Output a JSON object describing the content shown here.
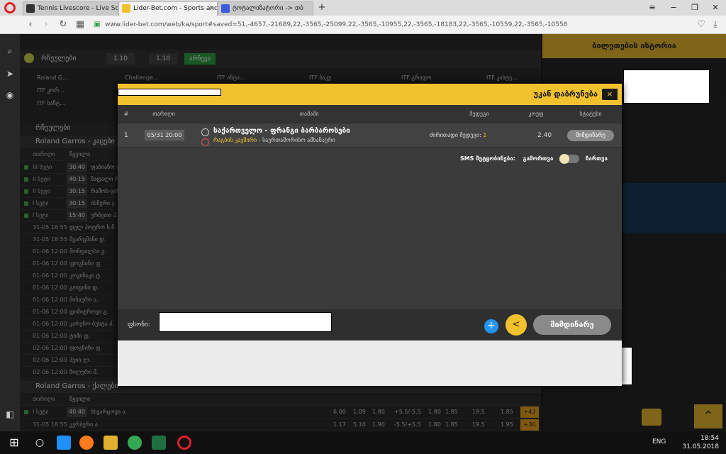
{
  "browser": {
    "tabs": [
      {
        "label": "Tennis Livescore - Live Sco"
      },
      {
        "label": "Lider-Bet.com - Sports and"
      },
      {
        "label": "ტოტალიზატორი -> თბ"
      }
    ],
    "new_tab": "+",
    "url": "www.lider-bet.com/web/ka/sport#saved=51,-4657,-21689,22,-3565,-25099,22,-3565,-10955,22,-3565,-18183,22,-3565,-10559,22,-3565,-10558"
  },
  "site": {
    "favorites_label": "რჩეულები",
    "odds_from": "1.10",
    "odds_to": "1.10",
    "filter_btn": "არჩევა",
    "fav_items": [
      "Roland G...",
      "Challenge...",
      "ITF ანტა...",
      "ITF ბაკუ",
      "ITF გრადო",
      "ITF კასტე...",
      "ITF კორ...",
      "ITF ხანტ..."
    ],
    "section1": "Roland Garros - კაცები",
    "section2": "Roland Garros - ქალები",
    "col_date": "თარიღი",
    "col_pair": "წყვილი",
    "rows": [
      {
        "t": "III სეტი",
        "s": "30:40",
        "n": "ფაბიანო ლ."
      },
      {
        "t": "II სეტი",
        "s": "40:15",
        "n": "ნადალი რ."
      },
      {
        "t": "II სეტი",
        "s": "30:15",
        "n": "რამოს-ვინ"
      },
      {
        "t": "I სეტი",
        "s": "30:15",
        "n": "ისნერი ჯ."
      },
      {
        "t": "I სეტი",
        "s": "15:40",
        "n": "ერბეთი პ."
      },
      {
        "t": "31-05 18:55",
        "n": "დელ პოტრო ხ.მ."
      },
      {
        "t": "31-05 18:55",
        "n": "შვარცმანი დ."
      },
      {
        "t": "01-06 12:00",
        "n": "მონფილსი გ."
      },
      {
        "t": "01-06 12:00",
        "n": "ფოგნინი ფ."
      },
      {
        "t": "01-06 12:00",
        "n": "კოკინაკი ტ."
      },
      {
        "t": "01-06 12:00",
        "n": "გოფინი დ."
      },
      {
        "t": "01-06 12:00",
        "n": "მინაური ა."
      },
      {
        "t": "01-06 12:00",
        "n": "დიმიტროვი გ."
      },
      {
        "t": "01-06 12:00",
        "n": "კარენო-ბუსტა პ."
      },
      {
        "t": "01-06 12:00",
        "n": "ტიმი დ."
      },
      {
        "t": "02-06 12:00",
        "n": "ფოგნინი ფ."
      },
      {
        "t": "02-06 12:00",
        "n": "პუიი ლ."
      },
      {
        "t": "02-06 12:00",
        "n": "ზილერი მ."
      }
    ],
    "bottom_rows": [
      {
        "t": "I სეტი",
        "s": "40:40",
        "n": "სხვარცოვი ა.",
        "odds": [
          "6.00",
          "1.09",
          "1.80",
          "+5.5/-5.5",
          "1.80",
          "1.85",
          "19.5",
          "1.85"
        ],
        "more": "+43"
      },
      {
        "t": "31-05 18:55",
        "n": "კერბერი ა.",
        "odds": [
          "1.17",
          "5.10",
          "1.90",
          "-5.5/+5.5",
          "1.80",
          "1.85",
          "19.5",
          "1.95"
        ],
        "more": "+30"
      }
    ],
    "history_title": "ბილეთების ისტორია"
  },
  "modal": {
    "back_label": "უკან დაბრუნება",
    "close_icon": "×",
    "columns": [
      "#",
      "თარიღი",
      "თამაში",
      "შედეგი",
      "კოეფ",
      "სტატუსი"
    ],
    "bet": {
      "num": "1",
      "date": "05/31 20:00",
      "match": "საქართველო - ფრანგი ბარბაროსები",
      "league": "რაგბის კავშირი",
      "league_suffix": "- საერთაშორისო ამხანაური",
      "pick_label": "ძირითადი შედეგი:",
      "pick_value": "1",
      "odd": "2.40",
      "status": "მიმდინარე"
    },
    "sms_label": "SMS შეტყობინება:",
    "sms_off": "გამორთვა",
    "sms_on": "ჩართვა",
    "sum_label": "ფსონი:",
    "plus_label": "+",
    "current_button": "მიმდინარე"
  },
  "taskbar": {
    "lang": "ENG",
    "time": "18:54",
    "date": "31.05.2018"
  }
}
